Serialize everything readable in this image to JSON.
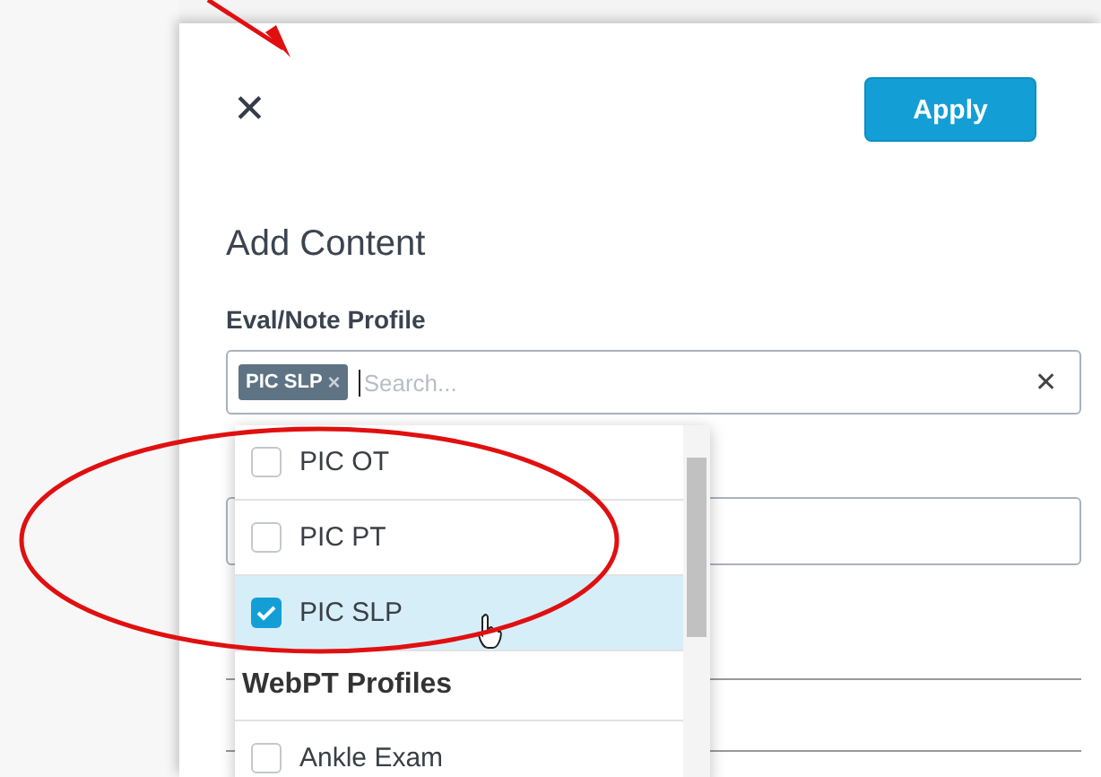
{
  "panel": {
    "close_label": "✕",
    "apply_button": "Apply",
    "title": "Add Content",
    "profile_field": {
      "label": "Eval/Note Profile",
      "chips": [
        {
          "label": "PIC SLP",
          "remove": "×"
        }
      ],
      "placeholder": "Search...",
      "clear": "✕"
    },
    "dropdown": {
      "options": [
        {
          "kind": "option",
          "label": "PIC OT",
          "checked": false,
          "highlighted": false
        },
        {
          "kind": "option",
          "label": "PIC PT",
          "checked": false,
          "highlighted": false
        },
        {
          "kind": "option",
          "label": "PIC SLP",
          "checked": true,
          "highlighted": true
        },
        {
          "kind": "group",
          "label": "WebPT Profiles"
        },
        {
          "kind": "option",
          "label": "Ankle Exam",
          "checked": false,
          "highlighted": false
        }
      ]
    }
  }
}
